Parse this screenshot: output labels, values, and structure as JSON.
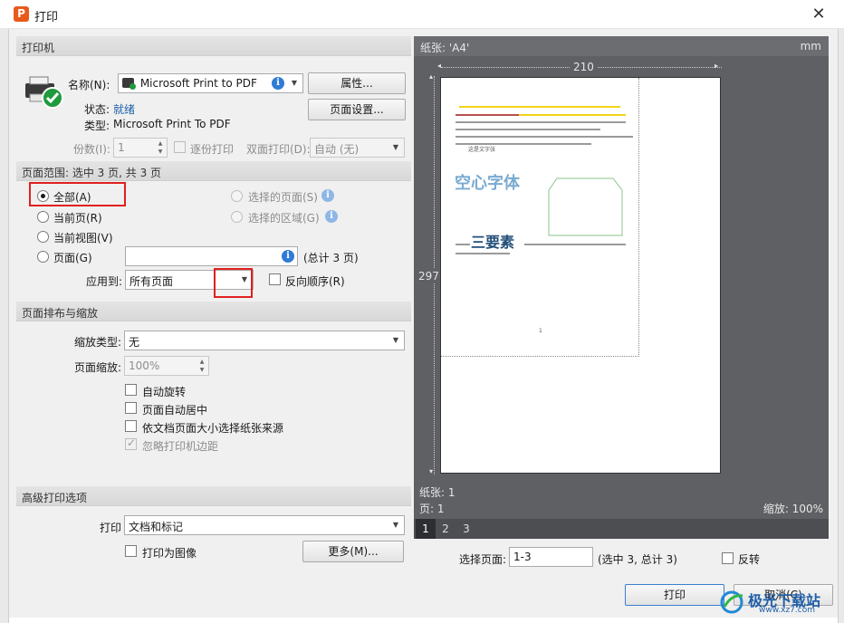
{
  "window": {
    "title": "打印",
    "app_icon_letter": "P"
  },
  "printer": {
    "group_title": "打印机",
    "name_label": "名称(N):",
    "name_value": "Microsoft Print to PDF",
    "status_label": "状态:",
    "status_value": "就绪",
    "type_label": "类型:",
    "type_value": "Microsoft Print To PDF",
    "properties_button": "属性...",
    "page_setup_button": "页面设置...",
    "copies_label": "份数(I):",
    "copies_value": "1",
    "collate_label": "逐份打印",
    "duplex_label": "双面打印(D):",
    "duplex_value": "自动 (无)"
  },
  "range": {
    "group_title": "页面范围: 选中 3 页, 共 3 页",
    "all_label": "全部(A)",
    "current_page_label": "当前页(R)",
    "current_view_label": "当前视图(V)",
    "pages_label": "页面(G)",
    "selected_pages_label": "选择的页面(S)",
    "selected_area_label": "选择的区域(G)",
    "pages_value": "",
    "total_label": "(总计 3 页)",
    "apply_to_label": "应用到:",
    "apply_to_value": "所有页面",
    "reverse_label": "反向顺序(R)"
  },
  "layout": {
    "group_title": "页面排布与缩放",
    "scale_type_label": "缩放类型:",
    "scale_type_value": "无",
    "page_scale_label": "页面缩放:",
    "page_scale_value": "100%",
    "auto_rotate_label": "自动旋转",
    "auto_center_label": "页面自动居中",
    "paper_source_label": "依文档页面大小选择纸张来源",
    "ignore_margin_label": "忽略打印机边距"
  },
  "advanced": {
    "group_title": "高级打印选项",
    "print_label": "打印",
    "print_value": "文档和标记",
    "print_as_image_label": "打印为图像",
    "more_button": "更多(M)..."
  },
  "preview": {
    "paper_label": "纸张: 'A4'",
    "unit": "mm",
    "width_mm": "210",
    "height_mm": "297",
    "paper_count": "纸张: 1",
    "page_count": "页: 1",
    "zoom": "缩放: 100%",
    "page_tabs": [
      "1",
      "2",
      "3"
    ],
    "doc_heading_1": "空心字体",
    "doc_heading_2": "三要素",
    "doc_caption": "这是文字张",
    "doc_page_number": "1"
  },
  "bottom": {
    "select_pages_label": "选择页面:",
    "select_pages_value": "1-3",
    "selection_info": "(选中 3, 总计 3)",
    "flip_label": "反转",
    "print_button": "打印",
    "cancel_button": "取消(C)"
  },
  "watermark": {
    "text": "极光下载站",
    "url": "www.xz7.com"
  },
  "colors": {
    "annotation_red": "#e02020",
    "accent_blue": "#2f7bd6",
    "preview_bg": "#5e6064"
  }
}
